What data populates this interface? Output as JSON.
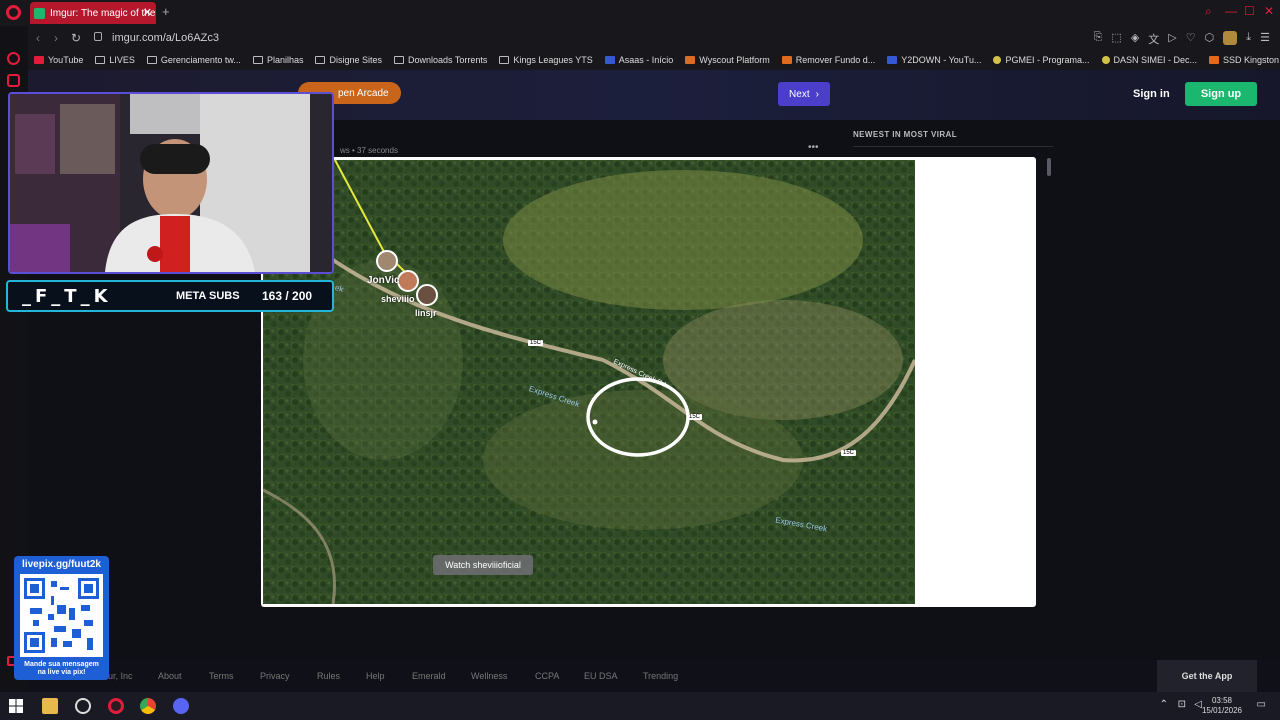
{
  "browser": {
    "tab_title": "Imgur: The magic of the Int",
    "url": "imgur.com/a/Lo6AZc3",
    "bookmarks": [
      {
        "label": "YouTube",
        "icon": "youtube-icon"
      },
      {
        "label": "LIVES",
        "icon": "folder-icon"
      },
      {
        "label": "Gerenciamento tw...",
        "icon": "folder-icon"
      },
      {
        "label": "Planilhas",
        "icon": "folder-icon"
      },
      {
        "label": "Disigne Sites",
        "icon": "folder-icon"
      },
      {
        "label": "Downloads Torrents",
        "icon": "folder-icon"
      },
      {
        "label": "Kings Leagues YTS",
        "icon": "folder-icon"
      },
      {
        "label": "Asaas - Início",
        "icon": "asaas-icon"
      },
      {
        "label": "Wyscout Platform",
        "icon": "wyscout-icon"
      },
      {
        "label": "Remover Fundo d...",
        "icon": "remove-bg-icon"
      },
      {
        "label": "Y2DOWN - YouTu...",
        "icon": "y2down-icon"
      },
      {
        "label": "PGMEI - Programa...",
        "icon": "pgmei-icon"
      },
      {
        "label": "DASN SIMEI - Dec...",
        "icon": "dasn-icon"
      },
      {
        "label": "SSD Kingston 1TB...",
        "icon": "kingston-icon"
      }
    ]
  },
  "imgur": {
    "next_label": "Next",
    "signin_label": "Sign in",
    "signup_label": "Sign up",
    "arcade_label": "pen Arcade",
    "meta_text": "ws • 37 seconds",
    "sidebar_heading": "NEWEST IN MOST VIRAL",
    "watch_label": "Watch sheviiioficial",
    "map_labels": {
      "player1": "JonVic",
      "player2": "sheviiio",
      "player3": "linsjr",
      "creek1": "Express Creek",
      "creek2": "Express Creek",
      "road": "Express Creek Rd",
      "marker1": "15C",
      "marker2": "15C",
      "marker3": "15C",
      "edge_label": "ek"
    },
    "footer_links": [
      "ur, Inc",
      "About",
      "Terms",
      "Privacy",
      "Rules",
      "Help",
      "Emerald",
      "Wellness",
      "CCPA",
      "EU DSA",
      "Trending"
    ],
    "get_app_label": "Get the App"
  },
  "stream_overlay": {
    "logo_text": "_F_T_K",
    "meta_label": "META SUBS",
    "meta_count": "163 / 200",
    "qr_url": "livepix.gg/fuut2k",
    "qr_message_1": "Mande sua mensagem",
    "qr_message_2": "na live via pix!"
  },
  "taskbar": {
    "time": "03:58",
    "date": "15/01/2026"
  },
  "colors": {
    "accent_red": "#e01e3c",
    "imgur_green": "#1bb76e",
    "imgur_purple": "#4b3fc9"
  }
}
